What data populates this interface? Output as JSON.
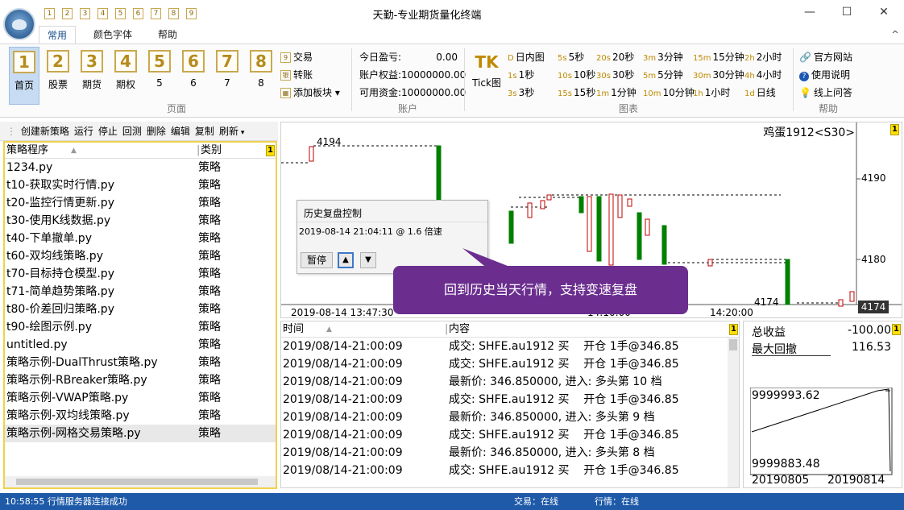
{
  "window": {
    "title": "天勤-专业期货量化终端",
    "number_tabs": [
      "1",
      "2",
      "3",
      "4",
      "5",
      "6",
      "7",
      "8",
      "9"
    ],
    "controls": {
      "minimize": "—",
      "maximize": "☐",
      "close": "✕",
      "collapse": "^"
    }
  },
  "menu_tabs": [
    "常用",
    "颜色字体",
    "帮助"
  ],
  "ribbon": {
    "pages_group": {
      "label": "页面",
      "buttons": [
        {
          "num": "1",
          "label": "首页"
        },
        {
          "num": "2",
          "label": "股票"
        },
        {
          "num": "3",
          "label": "期货"
        },
        {
          "num": "4",
          "label": "期权"
        },
        {
          "num": "5",
          "label": "5"
        },
        {
          "num": "6",
          "label": "6"
        },
        {
          "num": "7",
          "label": "7"
        },
        {
          "num": "8",
          "label": "8"
        }
      ],
      "small": [
        {
          "icon": "9",
          "label": "交易"
        },
        {
          "icon": "银",
          "label": "转账"
        },
        {
          "icon": "▦",
          "label": "添加板块 ▾"
        }
      ]
    },
    "account_group": {
      "label": "账户",
      "rows": [
        {
          "key": "今日盈亏:",
          "value": "0.00"
        },
        {
          "key": "账户权益:",
          "value": "10000000.00"
        },
        {
          "key": "可用资金:",
          "value": "10000000.00"
        }
      ]
    },
    "chart_group": {
      "label": "图表",
      "tick_label": "Tick图",
      "tick_icon": "TK",
      "columns": [
        [
          {
            "k": "D",
            "t": "日内图"
          },
          {
            "k": "1s",
            "t": "1秒"
          },
          {
            "k": "3s",
            "t": "3秒"
          }
        ],
        [
          {
            "k": "5s",
            "t": "5秒"
          },
          {
            "k": "10s",
            "t": "10秒"
          },
          {
            "k": "15s",
            "t": "15秒"
          }
        ],
        [
          {
            "k": "20s",
            "t": "20秒"
          },
          {
            "k": "30s",
            "t": "30秒"
          },
          {
            "k": "1m",
            "t": "1分钟"
          }
        ],
        [
          {
            "k": "3m",
            "t": "3分钟"
          },
          {
            "k": "5m",
            "t": "5分钟"
          },
          {
            "k": "10m",
            "t": "10分钟"
          }
        ],
        [
          {
            "k": "15m",
            "t": "15分钟"
          },
          {
            "k": "30m",
            "t": "30分钟"
          },
          {
            "k": "1h",
            "t": "1小时"
          }
        ],
        [
          {
            "k": "2h",
            "t": "2小时"
          },
          {
            "k": "4h",
            "t": "4小时"
          },
          {
            "k": "1d",
            "t": "日线"
          }
        ]
      ]
    },
    "help_group": {
      "label": "帮助",
      "items": [
        {
          "icon": "link-icon",
          "label": "官方网站"
        },
        {
          "icon": "question-icon",
          "label": "使用说明"
        },
        {
          "icon": "bulb-icon",
          "label": "线上问答"
        }
      ]
    }
  },
  "strategy": {
    "toolbar": [
      "创建新策略",
      "运行",
      "停止",
      "回测",
      "删除",
      "编辑",
      "复制",
      "刷新"
    ],
    "columns": [
      "策略程序",
      "类别"
    ],
    "badge": "1",
    "rows": [
      {
        "name": "1234.py",
        "type": "策略"
      },
      {
        "name": "t10-获取实时行情.py",
        "type": "策略"
      },
      {
        "name": "t20-监控行情更新.py",
        "type": "策略"
      },
      {
        "name": "t30-使用K线数据.py",
        "type": "策略"
      },
      {
        "name": "t40-下单撤单.py",
        "type": "策略"
      },
      {
        "name": "t60-双均线策略.py",
        "type": "策略"
      },
      {
        "name": "t70-目标持仓模型.py",
        "type": "策略"
      },
      {
        "name": "t71-简单趋势策略.py",
        "type": "策略"
      },
      {
        "name": "t80-价差回归策略.py",
        "type": "策略"
      },
      {
        "name": "t90-绘图示例.py",
        "type": "策略"
      },
      {
        "name": "untitled.py",
        "type": "策略"
      },
      {
        "name": "策略示例-DualThrust策略.py",
        "type": "策略"
      },
      {
        "name": "策略示例-RBreaker策略.py",
        "type": "策略"
      },
      {
        "name": "策略示例-VWAP策略.py",
        "type": "策略"
      },
      {
        "name": "策略示例-双均线策略.py",
        "type": "策略"
      },
      {
        "name": "策略示例-网格交易策略.py",
        "type": "策略"
      }
    ]
  },
  "chart": {
    "symbol": "鸡蛋1912<S30>",
    "badge": "1",
    "high_label": "4194",
    "low_label": "4174",
    "last_price": "4174",
    "y_ticks": [
      "4190",
      "4180"
    ],
    "x_labels": [
      "2019-08-14 13:47:30",
      "14:10:00",
      "14:20:00"
    ],
    "up_color": "#c00000",
    "down_color": "#008000"
  },
  "dialog": {
    "title": "历史复盘控制",
    "info": "2019-08-14 21:04:11 @ 1.6 倍速",
    "pause_label": "暂停",
    "up_label": "▲",
    "down_label": "▼"
  },
  "callout": "回到历史当天行情，支持变速复盘",
  "log": {
    "columns": [
      "时间",
      "内容"
    ],
    "badge": "1",
    "rows": [
      {
        "time": "2019/08/14-21:00:09",
        "content": "成交: SHFE.au1912 买    开仓 1手@346.85"
      },
      {
        "time": "2019/08/14-21:00:09",
        "content": "成交: SHFE.au1912 买    开仓 1手@346.85"
      },
      {
        "time": "2019/08/14-21:00:09",
        "content": "最新价: 346.850000, 进入: 多头第 10 档"
      },
      {
        "time": "2019/08/14-21:00:09",
        "content": "成交: SHFE.au1912 买    开仓 1手@346.85"
      },
      {
        "time": "2019/08/14-21:00:09",
        "content": "最新价: 346.850000, 进入: 多头第 9 档"
      },
      {
        "time": "2019/08/14-21:00:09",
        "content": "成交: SHFE.au1912 买    开仓 1手@346.85"
      },
      {
        "time": "2019/08/14-21:00:09",
        "content": "最新价: 346.850000, 进入: 多头第 8 档"
      },
      {
        "time": "2019/08/14-21:00:09",
        "content": "成交: SHFE.au1912 买    开仓 1手@346.85"
      }
    ]
  },
  "stats": {
    "total_pnl_label": "总收益",
    "total_pnl_value": "-100.00",
    "max_dd_label": "最大回撤",
    "max_dd_value": "116.53",
    "badge": "1",
    "equity_high": "9999993.62",
    "equity_low": "9999883.48",
    "date_start": "20190805",
    "date_end": "20190814"
  },
  "status": {
    "message": "10:58:55 行情服务器连接成功",
    "trade": "交易：在线",
    "quote": "行情：在线"
  }
}
